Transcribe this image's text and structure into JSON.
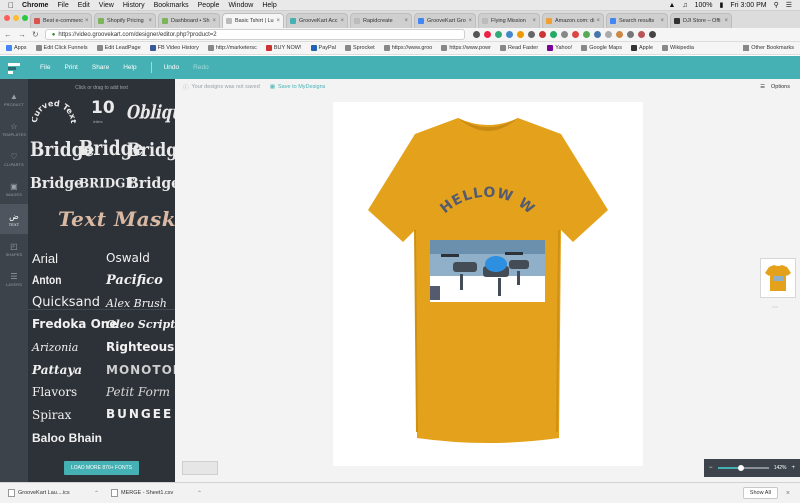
{
  "macbar": {
    "menus": [
      "Chrome",
      "File",
      "Edit",
      "View",
      "History",
      "Bookmarks",
      "People",
      "Window",
      "Help"
    ],
    "battery": "100%",
    "clock": "Fri 3:00 PM"
  },
  "browser": {
    "tabs": [
      {
        "label": "Best e-commerc"
      },
      {
        "label": "Shopify Pricing"
      },
      {
        "label": "Dashboard • Sh"
      },
      {
        "label": "Basic Tshirt | Lu",
        "active": true
      },
      {
        "label": "GrooveKart Acc"
      },
      {
        "label": "Rapidcreate"
      },
      {
        "label": "GrooveKart Gro"
      },
      {
        "label": "Flying Mission"
      },
      {
        "label": "Amazon.com: di"
      },
      {
        "label": "Search results"
      },
      {
        "label": "DJI Store – Offi"
      }
    ],
    "url": "https://video.groovekart.com/designer/editor.php?product=2",
    "bookmarks": [
      "Apps",
      "Edit Click Funnels",
      "Edit LeadPage",
      "FB Video History",
      "http://marketersc",
      "BUY NOW!",
      "PayPal",
      "Sprocket",
      "https://www.groo",
      "https://www.powr",
      "Read Faster",
      "Yahoo!",
      "Google Maps",
      "Apple",
      "Wikipedia"
    ],
    "other_bookmarks": "Other Bookmarks"
  },
  "app": {
    "menu": [
      "File",
      "Print",
      "Share",
      "Help"
    ],
    "undo": "Undo",
    "redo": "Redo",
    "sidebar": [
      {
        "label": "PRODUCT",
        "icon": "shirt-icon"
      },
      {
        "label": "TEMPLATES",
        "icon": "star-icon"
      },
      {
        "label": "CLIPARTS",
        "icon": "heart-icon"
      },
      {
        "label": "IMAGES",
        "icon": "image-icon"
      },
      {
        "label": "TEXT",
        "icon": "text-icon",
        "active": true
      },
      {
        "label": "SHAPES",
        "icon": "shapes-icon"
      },
      {
        "label": "LAYERS",
        "icon": "layers-icon"
      }
    ],
    "panel": {
      "hint": "Click or drag to add text",
      "styles": [
        "Curved Text",
        "10",
        "Oblique",
        "Bridge",
        "Bridge",
        "Bridge",
        "Bridge",
        "BRIDGE",
        "Bridge",
        "Text Mask"
      ],
      "style_caption": "letters",
      "fonts": [
        "Arial",
        "Oswald",
        "Anton",
        "Pacifico",
        "Quicksand",
        "Alex Brush",
        "Fredoka One",
        "Oleo Script Sw",
        "Arizonia",
        "Righteous",
        "Pattaya",
        "MONOTON",
        "Flavors",
        "Petit Form",
        "Spirax",
        "BUNGEE S",
        "Baloo Bhain"
      ],
      "load_more": "LOAD MORE 870+ FONTS"
    },
    "subbar": {
      "not_saved": "Your designs was not saved",
      "save": "Save to MyDesigns",
      "options": "Options"
    },
    "design": {
      "shirt_color": "#e4a21c",
      "arc_text": "HELLOW WORL",
      "accent": "#46b1b4"
    },
    "zoom": {
      "percent": "142%",
      "level": 0.45
    }
  },
  "downloads": {
    "items": [
      "GrooveKart Lau....ics",
      "MERGE - Sheet1.csv"
    ],
    "show_all": "Show All"
  }
}
